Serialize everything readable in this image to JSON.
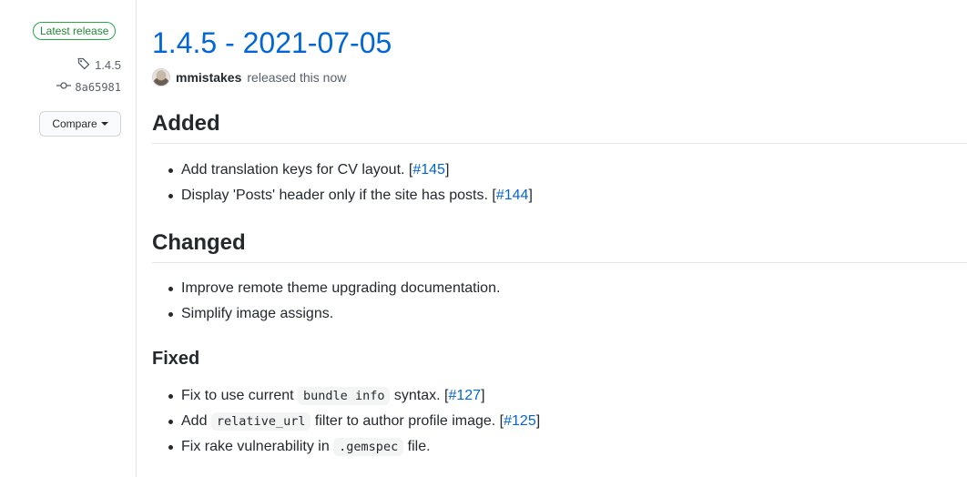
{
  "sidebar": {
    "badge": "Latest release",
    "tag": "1.4.5",
    "commit": "8a65981",
    "compare_label": "Compare"
  },
  "release": {
    "title": "1.4.5 - 2021-07-05",
    "author": "mmistakes",
    "released_text": "released this now"
  },
  "sections": {
    "added": {
      "heading": "Added",
      "items": [
        {
          "text": "Add translation keys for CV layout. [",
          "issue": "#145",
          "tail": "]"
        },
        {
          "text": "Display 'Posts' header only if the site has posts. [",
          "issue": "#144",
          "tail": "]"
        }
      ]
    },
    "changed": {
      "heading": "Changed",
      "items": [
        {
          "text": "Improve remote theme upgrading documentation."
        },
        {
          "text": "Simplify image assigns."
        }
      ]
    },
    "fixed": {
      "heading": "Fixed",
      "items": [
        {
          "pre": "Fix to use current ",
          "code": "bundle info",
          "post": " syntax. [",
          "issue": "#127",
          "tail": "]"
        },
        {
          "pre": "Add ",
          "code": "relative_url",
          "post": " filter to author profile image. [",
          "issue": "#125",
          "tail": "]"
        },
        {
          "pre": "Fix rake vulnerability in ",
          "code": ".gemspec",
          "post": " file."
        }
      ]
    }
  },
  "colors": {
    "link": "#0366d6",
    "badge_green": "#28a745"
  }
}
